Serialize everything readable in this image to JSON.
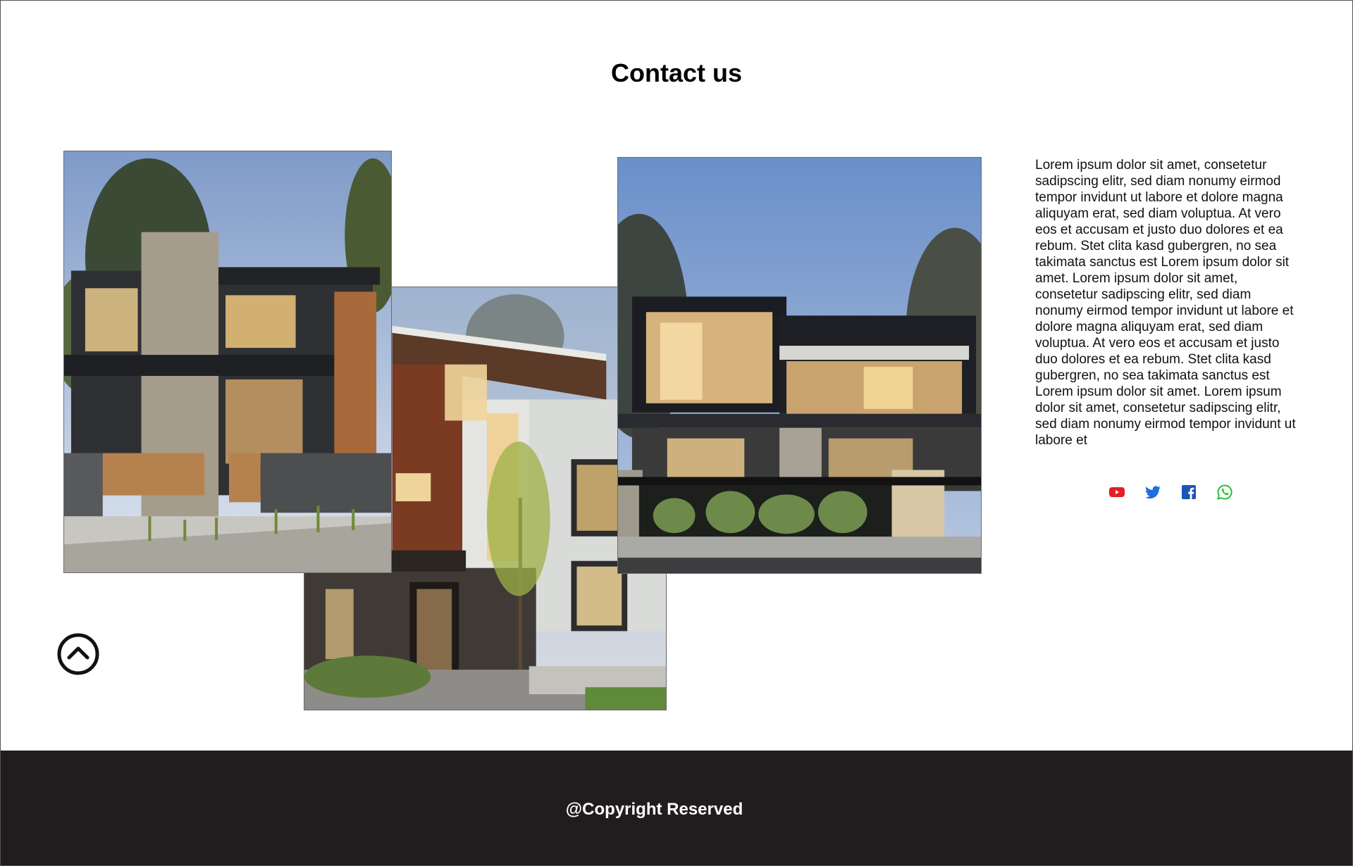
{
  "header": {
    "title": "Contact us"
  },
  "gallery": {
    "images": [
      {
        "alt": "Modern two-storey house with stone chimney and wood cladding"
      },
      {
        "alt": "Modern house with dark wood soffit and large windows at dusk"
      },
      {
        "alt": "Contemporary dark-framed villa with illuminated terraces"
      }
    ]
  },
  "content": {
    "paragraph": "Lorem ipsum dolor sit amet, consetetur sadipscing elitr, sed diam nonumy eirmod tempor invidunt ut labore et dolore magna aliquyam erat, sed diam voluptua. At vero eos et accusam et justo duo dolores et ea rebum. Stet clita kasd gubergren, no sea takimata sanctus est Lorem ipsum dolor sit amet. Lorem ipsum dolor sit amet, consetetur sadipscing elitr, sed diam nonumy eirmod tempor invidunt ut labore et dolore magna aliquyam erat, sed diam voluptua. At vero eos et accusam et justo duo dolores et ea rebum. Stet clita kasd gubergren, no sea takimata sanctus est Lorem ipsum dolor sit amet. Lorem ipsum dolor sit amet, consetetur sadipscing elitr, sed diam nonumy eirmod tempor invidunt ut labore et"
  },
  "social": {
    "icons": [
      "youtube-icon",
      "twitter-icon",
      "facebook-icon",
      "whatsapp-icon"
    ],
    "colors": {
      "youtube": "#e21f26",
      "twitter": "#1d6fe0",
      "facebook": "#1a55b8",
      "whatsapp": "#25c23a"
    }
  },
  "scroll_top": {
    "icon": "chevron-up-circle-icon"
  },
  "footer": {
    "text": "@Copyright Reserved",
    "background": "#211d1e"
  }
}
